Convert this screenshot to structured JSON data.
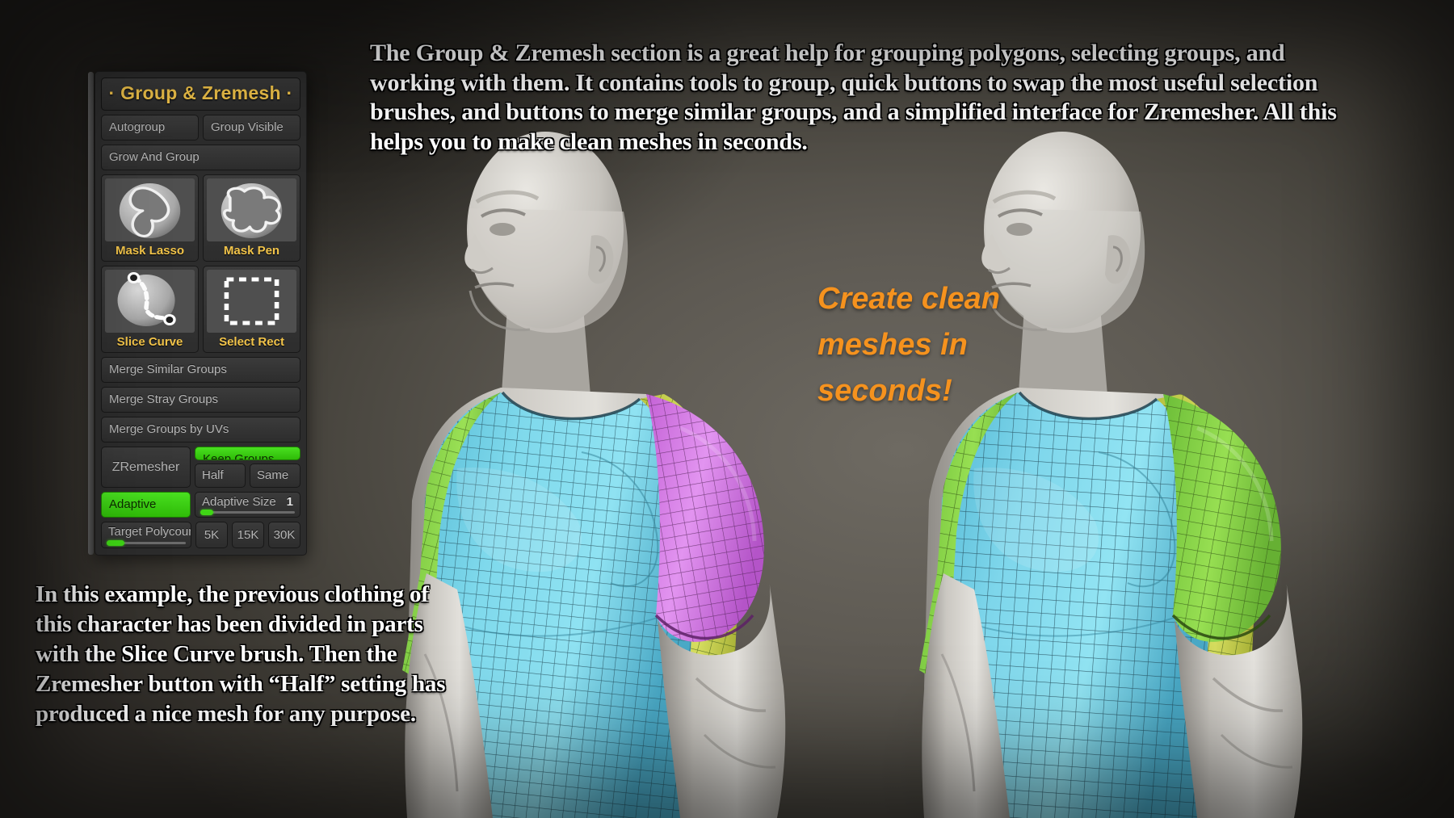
{
  "narration": {
    "intro": "The Group & Zremesh section is a great help for grouping polygons, selecting groups, and working with them. It contains tools to group, quick buttons to swap the most useful selection brushes, and buttons to merge similar groups, and a simplified interface for Zremesher. All this helps you to make clean meshes in seconds.",
    "tagline": "Create clean meshes in seconds!",
    "example": "In this example, the previous clothing of this character has been divided in parts with the Slice Curve brush. Then the Zremesher button with “Half” setting has produced a nice mesh for any purpose."
  },
  "panel": {
    "title": "· Group & Zremesh ·",
    "buttons": {
      "autogroup": "Autogroup",
      "group_visible": "Group Visible",
      "grow_and_group": "Grow And Group",
      "merge_similar": "Merge Similar Groups",
      "merge_stray": "Merge Stray Groups",
      "merge_uvs": "Merge Groups by UVs",
      "zremesher": "ZRemesher",
      "keep_groups": "Keep Groups",
      "half": "Half",
      "same": "Same",
      "adaptive": "Adaptive"
    },
    "brushes": [
      {
        "label": "Mask Lasso",
        "icon": "mask-lasso-icon"
      },
      {
        "label": "Mask Pen",
        "icon": "mask-pen-icon"
      },
      {
        "label": "Slice Curve",
        "icon": "slice-curve-icon"
      },
      {
        "label": "Select Rect",
        "icon": "select-rect-icon"
      }
    ],
    "sliders": {
      "adaptive_size_label": "Adaptive Size",
      "adaptive_size_value": "1",
      "adaptive_size_fill_pct": 14,
      "target_polycount_label": "Target Polycoun",
      "target_polycount_fill_pct": 22
    },
    "polycount_presets": [
      "5K",
      "15K",
      "30K"
    ],
    "active_states": {
      "keep_groups": true,
      "adaptive": true
    }
  },
  "colors": {
    "accent_orange": "#f5921e",
    "title_gold": "#f2c44a",
    "active_green": "#3fd615",
    "polygroup_cyan": "#6fd2e8",
    "polygroup_magenta": "#dd82e8",
    "polygroup_green": "#8ddc52",
    "polygroup_olive": "#cdd94f",
    "skin": "#c9c6c0",
    "background": "#5d5952"
  },
  "figures": [
    {
      "name": "figure-left-sliced",
      "shirt_groups": [
        "cyan-torso",
        "magenta-right-sleeve",
        "green-left-sleeve",
        "olive-side-panel"
      ]
    },
    {
      "name": "figure-right-remeshed",
      "shirt_groups": [
        "cyan-torso",
        "green-right-sleeve",
        "green-left-sleeve",
        "olive-side-panel"
      ]
    }
  ]
}
